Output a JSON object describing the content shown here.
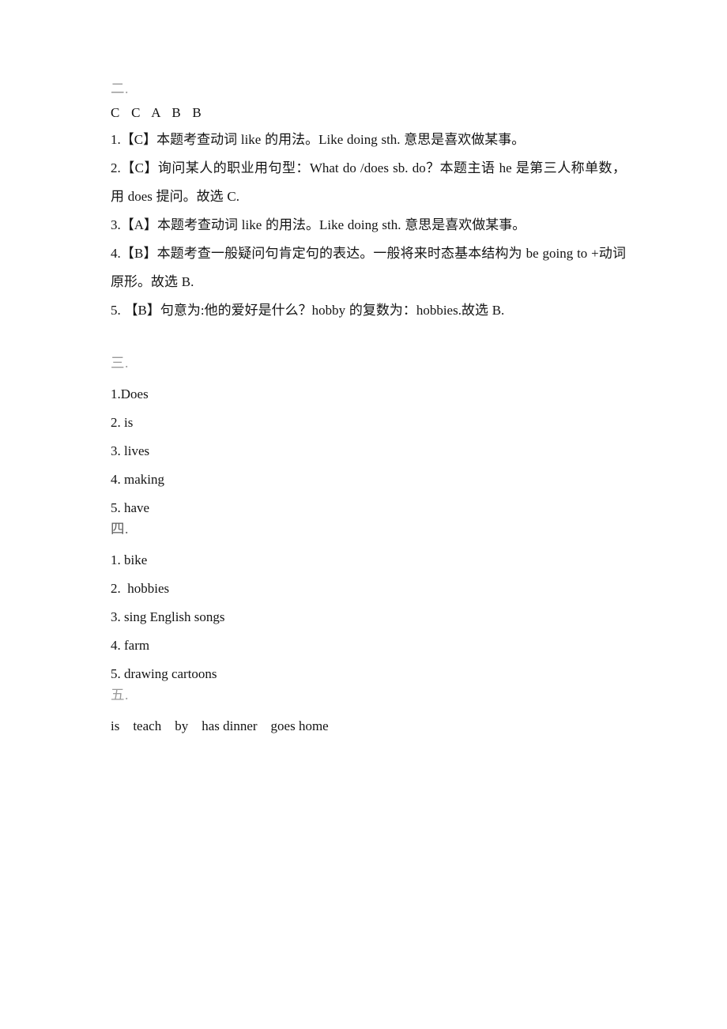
{
  "document": {
    "background_color": "#ffffff",
    "text_color": "#141414",
    "heading_color": "#9a9a9a"
  },
  "sections": [
    {
      "id": "section-2",
      "heading": "二.",
      "answer_key": "C   C   A   B   B",
      "explanations": [
        {
          "number": "1.",
          "choice": "【C】",
          "text": "本题考查动词 like 的用法。Like doing sth.  意思是喜欢做某事。"
        },
        {
          "number": "2.",
          "choice": "【C】",
          "text": "询问某人的职业用句型：What do /does sb. do？本题主语  he  是第三人称单数，用 does  提问。故选 C."
        },
        {
          "number": "3.",
          "choice": "【A】",
          "text": "本题考查动词 like 的用法。Like doing sth.  意思是喜欢做某事。"
        },
        {
          "number": "4.",
          "choice": "【B】",
          "text": "本题考查一般疑问句肯定句的表达。一般将来时态基本结构为 be going to +动词原形。故选 B."
        },
        {
          "number": "5. ",
          "choice": "【B】",
          "text": "句意为:他的爱好是什么？hobby 的复数为：hobbies.故选 B."
        }
      ]
    },
    {
      "id": "section-3",
      "heading": "三.",
      "items": [
        "1.Does",
        "2. is",
        "3. lives",
        "4. making",
        "5. have"
      ]
    },
    {
      "id": "section-4",
      "heading": "四.",
      "items": [
        "1. bike",
        "2.  hobbies",
        "3. sing English songs",
        "4. farm",
        "5. drawing cartoons"
      ]
    },
    {
      "id": "section-5",
      "heading": "五.",
      "answer_row": "is    teach    by    has dinner    goes home"
    }
  ]
}
